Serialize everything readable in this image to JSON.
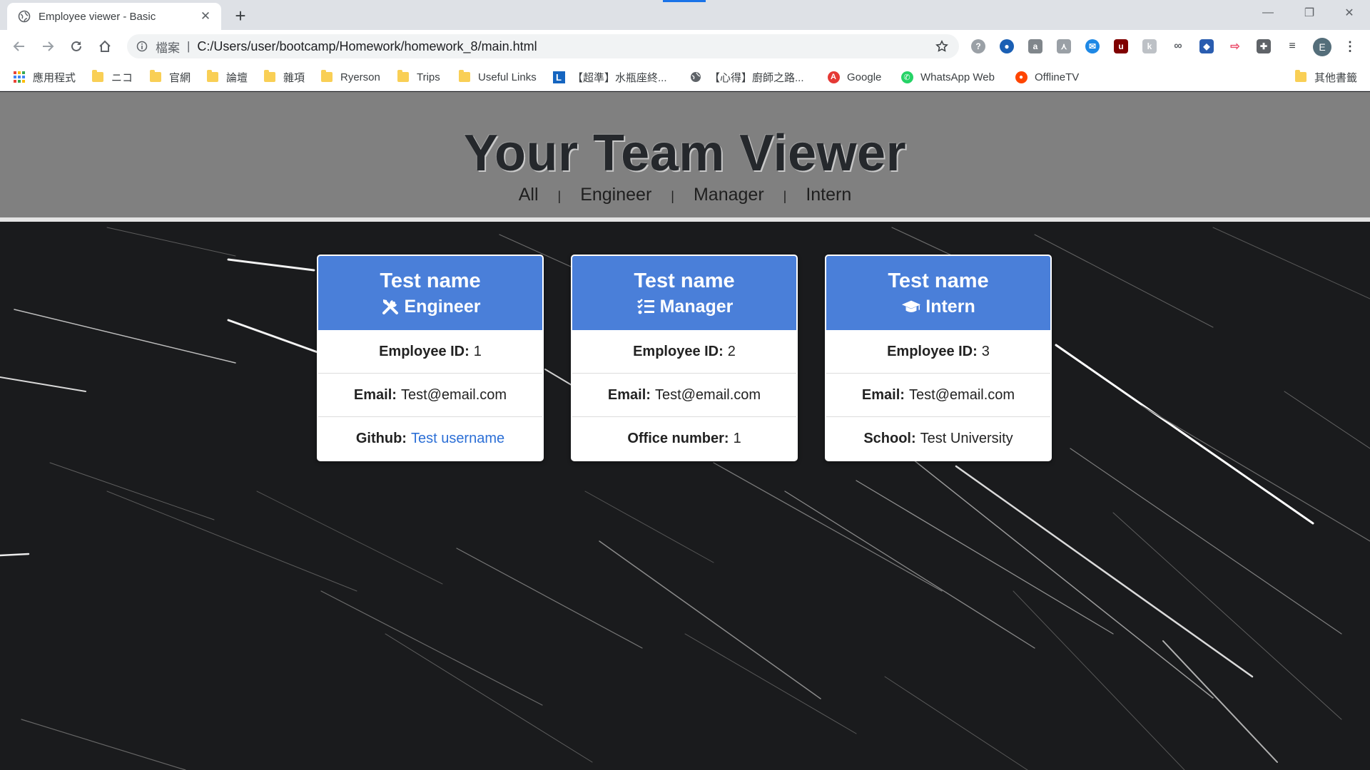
{
  "browser": {
    "tab_title": "Employee viewer - Basic",
    "url_scheme_label": "檔案",
    "url": "C:/Users/user/bootcamp/Homework/homework_8/main.html",
    "profile_initial": "E",
    "bookmarks": [
      {
        "label": "應用程式",
        "icon": "apps-grid-icon"
      },
      {
        "label": "ニコ",
        "icon": "folder-icon"
      },
      {
        "label": "官網",
        "icon": "folder-icon"
      },
      {
        "label": "論壇",
        "icon": "folder-icon"
      },
      {
        "label": "雜項",
        "icon": "folder-icon"
      },
      {
        "label": "Ryerson",
        "icon": "folder-icon"
      },
      {
        "label": "Trips",
        "icon": "folder-icon"
      },
      {
        "label": "Useful Links",
        "icon": "folder-icon"
      },
      {
        "label": "【超準】水瓶座終...",
        "icon": "site-l-icon"
      },
      {
        "label": "【心得】廚師之路...",
        "icon": "globe-icon"
      },
      {
        "label": "Google",
        "icon": "google-icon"
      },
      {
        "label": "WhatsApp Web",
        "icon": "whatsapp-icon"
      },
      {
        "label": "OfflineTV",
        "icon": "reddit-icon"
      },
      {
        "label": "其他書籤",
        "icon": "folder-icon"
      }
    ]
  },
  "page": {
    "title": "Your Team Viewer",
    "nav": [
      "All",
      "Engineer",
      "Manager",
      "Intern"
    ],
    "separator": "|"
  },
  "cards": [
    {
      "name": "Test name",
      "role": "Engineer",
      "role_icon": "tools-icon",
      "rows": [
        {
          "label": "Employee ID:",
          "value": "1"
        },
        {
          "label": "Email:",
          "value": "Test@email.com"
        },
        {
          "label": "Github:",
          "value": "Test username",
          "link": true
        }
      ]
    },
    {
      "name": "Test name",
      "role": "Manager",
      "role_icon": "tasks-list-icon",
      "rows": [
        {
          "label": "Employee ID:",
          "value": "2"
        },
        {
          "label": "Email:",
          "value": "Test@email.com"
        },
        {
          "label": "Office number:",
          "value": "1"
        }
      ]
    },
    {
      "name": "Test name",
      "role": "Intern",
      "role_icon": "graduation-cap-icon",
      "rows": [
        {
          "label": "Employee ID:",
          "value": "3"
        },
        {
          "label": "Email:",
          "value": "Test@email.com"
        },
        {
          "label": "School:",
          "value": "Test University"
        }
      ]
    }
  ],
  "colors": {
    "card_header": "#4a7fd9",
    "header_bg": "#808080",
    "link": "#2c6fd6"
  }
}
